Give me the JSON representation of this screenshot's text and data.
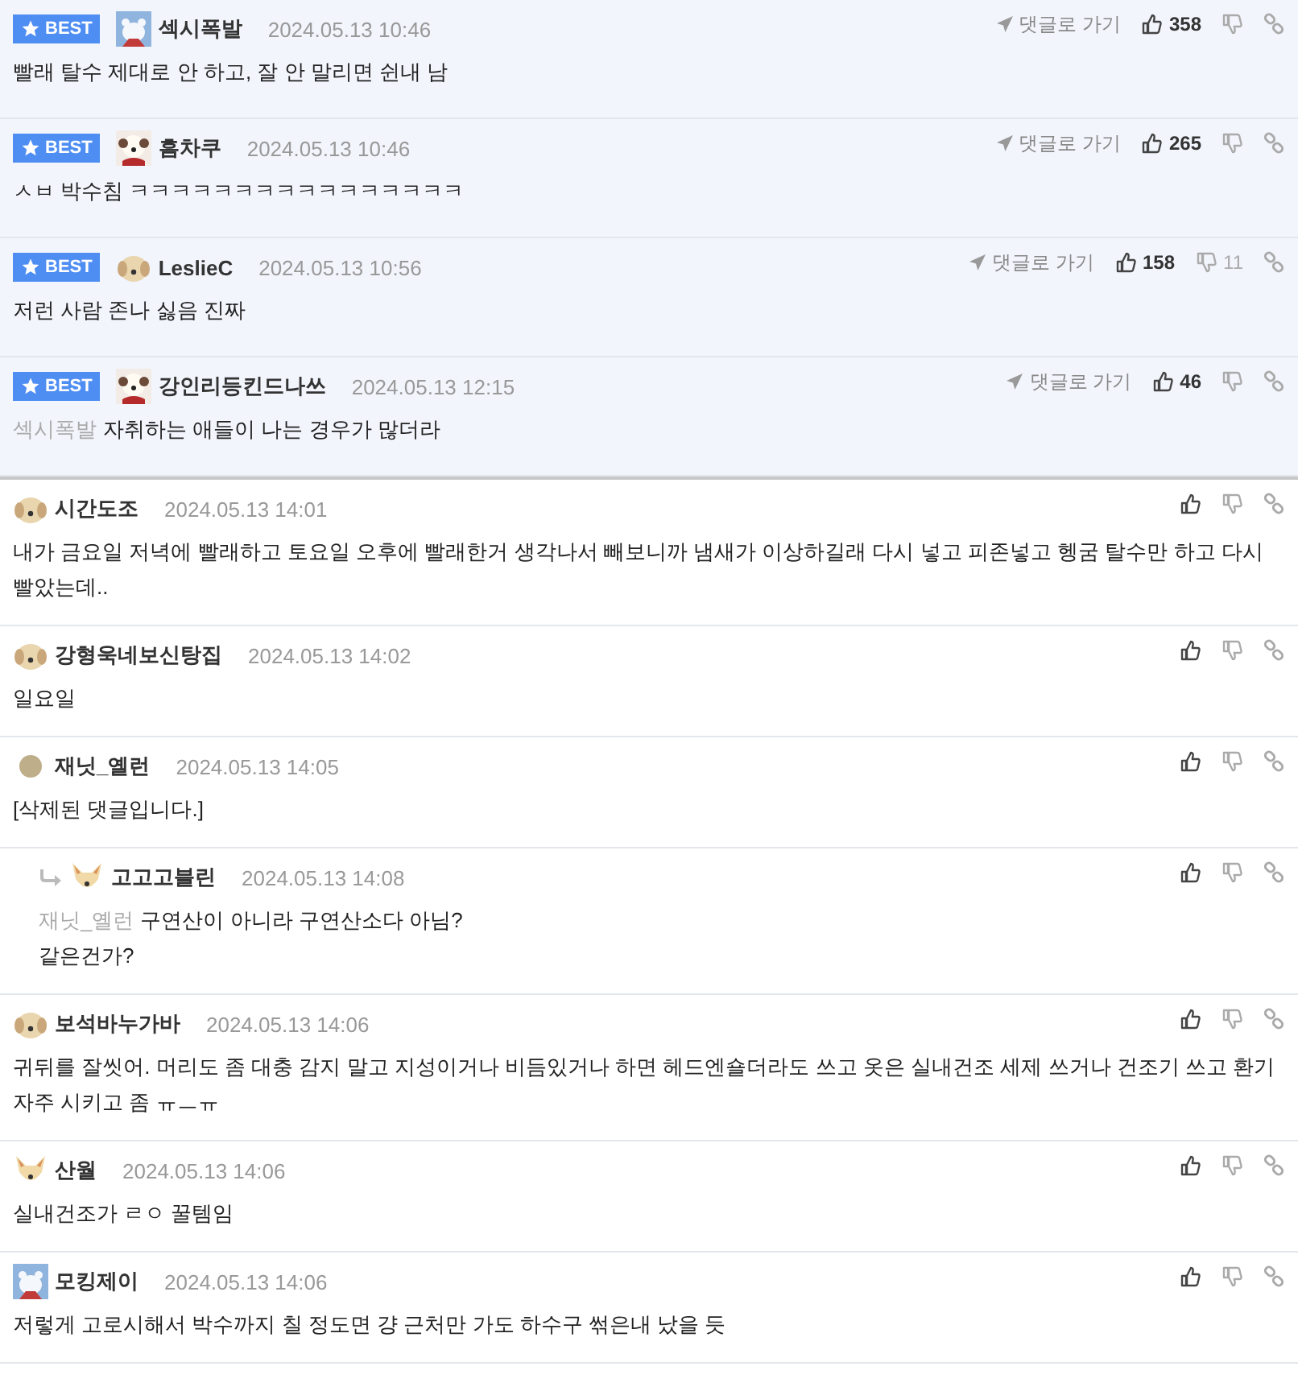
{
  "comments": [
    {
      "kind": "best",
      "badge": "BEST",
      "avatar": {
        "kind": "bear"
      },
      "nickname": "섹시폭발",
      "date": "2024.05.13 10:46",
      "goto": "댓글로 가기",
      "likes": "358",
      "text": "빨래 탈수 제대로 안 하고, 잘 안 말리면 쉰내 남"
    },
    {
      "kind": "best",
      "badge": "BEST",
      "avatar": {
        "kind": "scarf-dog"
      },
      "nickname": "흠차쿠",
      "date": "2024.05.13 10:46",
      "goto": "댓글로 가기",
      "likes": "265",
      "text": "ㅅㅂ 박수침 ㅋㅋㅋㅋㅋㅋㅋㅋㅋㅋㅋㅋㅋㅋㅋㅋ"
    },
    {
      "kind": "best",
      "badge": "BEST",
      "avatar": {
        "kind": "puppy"
      },
      "nickname": "LeslieC",
      "date": "2024.05.13 10:56",
      "goto": "댓글로 가기",
      "likes": "158",
      "dislikes": "11",
      "text": "저런 사람 존나 싫음 진짜"
    },
    {
      "kind": "best",
      "badge": "BEST",
      "avatar": {
        "kind": "scarf-dog"
      },
      "nickname": "강인리등킨드나쓰",
      "date": "2024.05.13 12:15",
      "goto": "댓글로 가기",
      "likes": "46",
      "mention": "섹시폭발",
      "text": "자취하는 애들이 나는 경우가 많더라"
    },
    {
      "kind": "normal",
      "avatar": {
        "kind": "puppy"
      },
      "nickname": "시간도조",
      "date": "2024.05.13 14:01",
      "text": "내가 금요일 저녁에 빨래하고 토요일 오후에 빨래한거 생각나서 빼보니까 냄새가 이상하길래 다시 넣고 피존넣고 헹굼 탈수만 하고 다시 빨았는데.."
    },
    {
      "kind": "normal",
      "avatar": {
        "kind": "puppy"
      },
      "nickname": "강형욱네보신탕집",
      "date": "2024.05.13 14:02",
      "text": "일요일"
    },
    {
      "kind": "normal",
      "avatar": {
        "kind": "dot"
      },
      "nickname": "재닛_옐런",
      "date": "2024.05.13 14:05",
      "text": "[삭제된 댓글입니다.]"
    },
    {
      "kind": "reply",
      "avatar": {
        "kind": "fox"
      },
      "nickname": "고고고블린",
      "date": "2024.05.13 14:08",
      "mention": "재닛_옐런",
      "text": "구연산이 아니라 구연산소다 아님?\n같은건가?"
    },
    {
      "kind": "normal",
      "avatar": {
        "kind": "puppy"
      },
      "nickname": "보석바누가바",
      "date": "2024.05.13 14:06",
      "text": "귀뒤를 잘씻어. 머리도 좀 대충 감지 말고 지성이거나 비듬있거나 하면 헤드엔숄더라도 쓰고 옷은 실내건조 세제 쓰거나 건조기 쓰고 환기 자주 시키고 좀 ㅠㅡㅠ"
    },
    {
      "kind": "normal",
      "avatar": {
        "kind": "fox"
      },
      "nickname": "산월",
      "date": "2024.05.13 14:06",
      "text": "실내건조가 ㄹㅇ 꿀템임"
    },
    {
      "kind": "normal",
      "avatar": {
        "kind": "bear"
      },
      "nickname": "모킹제이",
      "date": "2024.05.13 14:06",
      "text": "저렇게 고로시해서 박수까지 칠 정도면 걍 근처만 가도 하수구 썪은내 났을 듯"
    }
  ]
}
